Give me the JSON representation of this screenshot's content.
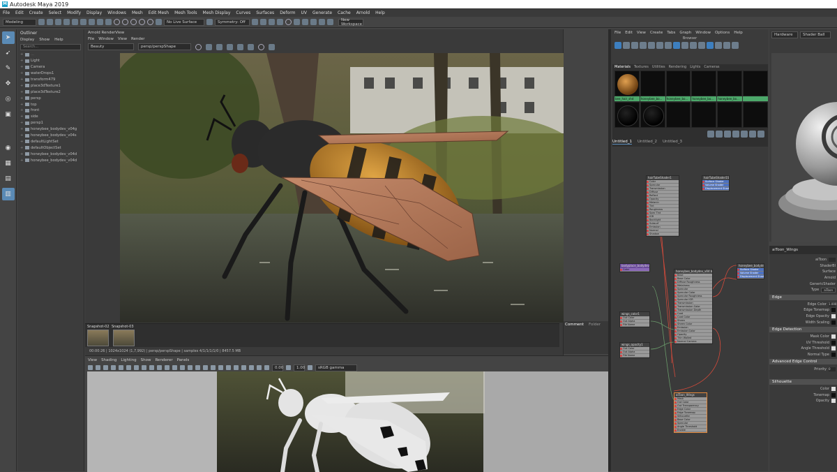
{
  "titlebar": {
    "logo": "M",
    "title": "Autodesk Maya 2019"
  },
  "menubar": [
    "File",
    "Edit",
    "Create",
    "Select",
    "Modify",
    "Display",
    "Windows",
    "Mesh",
    "Edit Mesh",
    "Mesh Tools",
    "Mesh Display",
    "Curves",
    "Surfaces",
    "Deform",
    "UV",
    "Generate",
    "Cache",
    "Arnold",
    "Help"
  ],
  "shelf": {
    "mode": "Modeling",
    "live_surface": "No Live Surface",
    "symmetry": "Symmetry: Off",
    "workspace": "New Workspace"
  },
  "outliner": {
    "title": "Outliner",
    "menu": [
      "Display",
      "Show",
      "Help"
    ],
    "search_placeholder": "Search...",
    "items": [
      "...",
      "Light",
      "Camera",
      "waterDrops1",
      "transform479",
      "place3dTexture1",
      "place3dTexture2",
      "persp",
      "top",
      "front",
      "side",
      "persp1",
      "honeybee_bodydev_v04g",
      "honeybee_bodydev_v04s",
      "defaultLightSet",
      "defaultObjectSet",
      "honeybee_bodydev_v04d",
      "honeybee_bodydev_v04d"
    ]
  },
  "renderview": {
    "title": "Arnold RenderView",
    "menu": [
      "File",
      "Window",
      "View",
      "Render"
    ],
    "beauty": "Beauty",
    "camera": "persp/perspShape",
    "snapshot1": "Snapshot-02",
    "snapshot2": "Snapshot-03",
    "status": "00:00:26 | 1024x1024 (1,7,992) | persp/perspShape | samples 4/1/1/1/1/0 | 8457.5 MB",
    "side_tabs": [
      "Comment",
      "Folder"
    ]
  },
  "viewport": {
    "menu": [
      "View",
      "Shading",
      "Lighting",
      "Show",
      "Renderer",
      "Panels"
    ],
    "value1": "0.00",
    "value2": "1.00",
    "colorspace": "sRGB gamma"
  },
  "hypershade": {
    "menu": [
      "File",
      "Edit",
      "View",
      "Create",
      "Tabs",
      "Graph",
      "Window",
      "Options",
      "Help"
    ],
    "browser_title": "Browser",
    "browser_tabs": [
      "Materials",
      "Textures",
      "Utilities",
      "Rendering",
      "Lights",
      "Cameras"
    ],
    "swatch_labels": [
      "bee_hair_shd",
      "honeybee_bo...",
      "honeybee_bo...",
      "honeybee_bo...",
      "honeybee_bo...",
      ""
    ],
    "work_tabs": [
      "Untitled_1",
      "Untitled_2",
      "Untitled_3"
    ],
    "nodes": {
      "n1": {
        "title": "hairTubeShader1",
        "rows": [
          "Color",
          "Specular",
          "Transmission",
          "Diffuse",
          "Reflect",
          "Opacity",
          "Melanin",
          "Tint",
          "Roughness",
          "Spec Tint",
          "IOR",
          "Backlight",
          "Subsurf",
          "Emission",
          "Normal",
          "Shadow"
        ]
      },
      "n2": {
        "title": "hairTubeShader1SG",
        "rows": [
          "Surface Shader",
          "Volume Shader",
          "Displacement Shader"
        ]
      },
      "n3": {
        "title": "bodyplace_bodydev_v04 aiImageFile1",
        "rows": [
          "Color"
        ]
      },
      "n4": {
        "title": "honeybee_bodydev_v04 bee_Wings",
        "rows": [
          "Base",
          "Base Color",
          "Diffuse Roughness",
          "Metalness",
          "Specular",
          "Specular Color",
          "Specular Roughness",
          "Specular IOR",
          "Transmission",
          "Transmission Color",
          "Transmission Depth",
          "Coat",
          "Coat Color",
          "Sheen",
          "Sheen Color",
          "Emission",
          "Emission Color",
          "Opacity",
          "Thin Walled",
          "Normal Camera"
        ]
      },
      "n5": {
        "title": "honeybee_bodydev_v04 aiStandardSurface SG",
        "rows": [
          "Surface Shader",
          "Volume Shader",
          "Displacement Shader"
        ]
      },
      "n6": {
        "title": "wings_color1",
        "rows": [
          "Out Color",
          "Out Alpha",
          "File Name"
        ]
      },
      "n7": {
        "title": "wings_opacity1",
        "rows": [
          "Out Color",
          "Out Alpha",
          "File Name"
        ]
      },
      "n8": {
        "title": "aiToon_Wings",
        "rows": [
          "Mask",
          "Out Color",
          "Out Transparency",
          "Edge Color",
          "Edge Tonemap",
          "Silhouette",
          "Base Color",
          "Specular",
          "Angle Threshold",
          "Enable"
        ]
      }
    }
  },
  "attributes": {
    "node_tab": "aiToon_Wings",
    "node_name": "aiToon",
    "types": [
      "ShaderBl",
      "Surface",
      "Arnold",
      "GenericShader"
    ],
    "type_label": "Type",
    "type_value": "aiToon",
    "sections": {
      "edge": {
        "title": "Edge",
        "rows": [
          "Edge Color",
          "Edge Tonemap",
          "Edge Opacity",
          "Width Scaling"
        ],
        "values": [
          "1.000"
        ]
      },
      "edge_detection": {
        "title": "Edge Detection",
        "rows": [
          "Mask Color",
          "UV Threshold",
          "Angle Threshold",
          "Normal Type"
        ]
      },
      "adv": {
        "title": "Advanced Edge Control",
        "rows": [
          "Priority"
        ],
        "values": [
          "0"
        ]
      },
      "sil": {
        "title": "Silhouette",
        "rows": [
          "Color",
          "Tonemap",
          "Opacity"
        ]
      }
    }
  },
  "preview": {
    "dd1": "Hardware",
    "dd2": "Shader Ball"
  }
}
